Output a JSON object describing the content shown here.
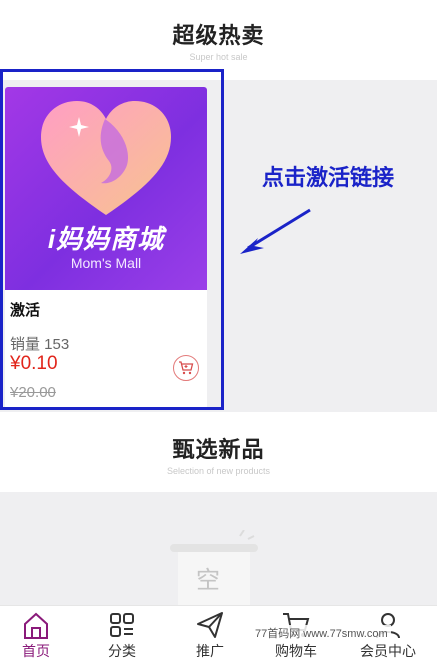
{
  "hot_section": {
    "title": "超级热卖",
    "subtitle": "Super hot sale"
  },
  "product": {
    "brand_main": "i妈妈商城",
    "brand_sub": "Mom's Mall",
    "name": "激活",
    "sales": "销量 153",
    "price": "¥0.10",
    "original_price": "¥20.00",
    "cart_icon": "cart-icon"
  },
  "annotation": {
    "text": "点击激活链接",
    "color": "#1a23c8"
  },
  "new_section": {
    "title": "甄选新品",
    "subtitle": "Selection of new products",
    "empty_text": "空"
  },
  "tabbar": [
    {
      "label": "首页",
      "icon": "home-icon",
      "active": true
    },
    {
      "label": "分类",
      "icon": "category-icon",
      "active": false
    },
    {
      "label": "推广",
      "icon": "send-icon",
      "active": false
    },
    {
      "label": "购物车",
      "icon": "cart-icon",
      "active": false
    },
    {
      "label": "会员中心",
      "icon": "user-icon",
      "active": false
    }
  ],
  "watermark": "77首码网 www.77smw.com",
  "colors": {
    "accent": "#8a1a7a",
    "price": "#e1251b",
    "product_bg": "#8e35e4"
  }
}
